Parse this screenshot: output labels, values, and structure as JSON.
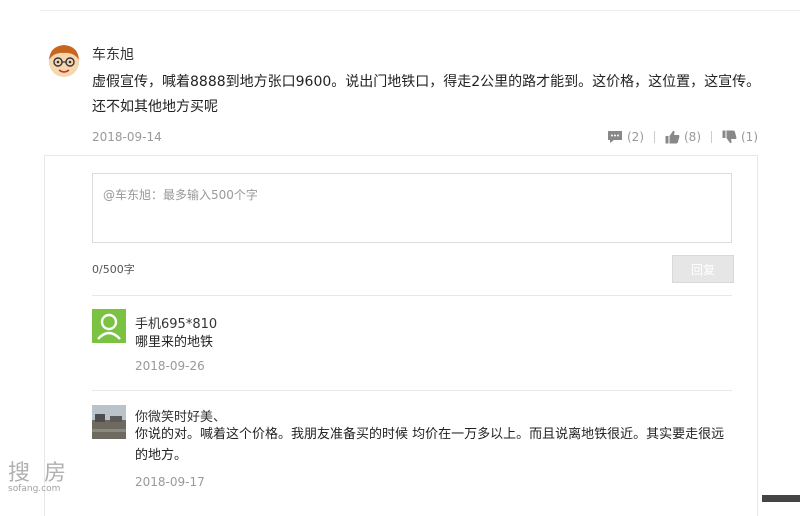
{
  "comment": {
    "author": "车东旭",
    "text": "虚假宣传，喊着8888到地方张口9600。说出门地铁口，得走2公里的路才能到。这价格，这位置，这宣传。还不如其他地方买呢",
    "date": "2018-09-14",
    "actions": {
      "reply_count": "(2)",
      "like_count": "(8)",
      "dislike_count": "(1)"
    }
  },
  "reply_form": {
    "placeholder": "@车东旭：最多输入500个字",
    "char_count": "0/500字",
    "submit_label": "回复"
  },
  "replies": [
    {
      "author": "手机695*810",
      "text": "哪里来的地铁",
      "date": "2018-09-26",
      "avatar_color": "#7cc242"
    },
    {
      "author": "你微笑时好美、",
      "text": "你说的对。喊着这个价格。我朋友准备买的时候 均价在一万多以上。而且说离地铁很近。其实要走很远的地方。",
      "date": "2018-09-17"
    }
  ],
  "watermark": {
    "logo": "搜房",
    "domain": "sofang.com"
  },
  "colors": {
    "icon": "#888888",
    "muted_text": "#999999",
    "border": "#e8e8e8"
  }
}
